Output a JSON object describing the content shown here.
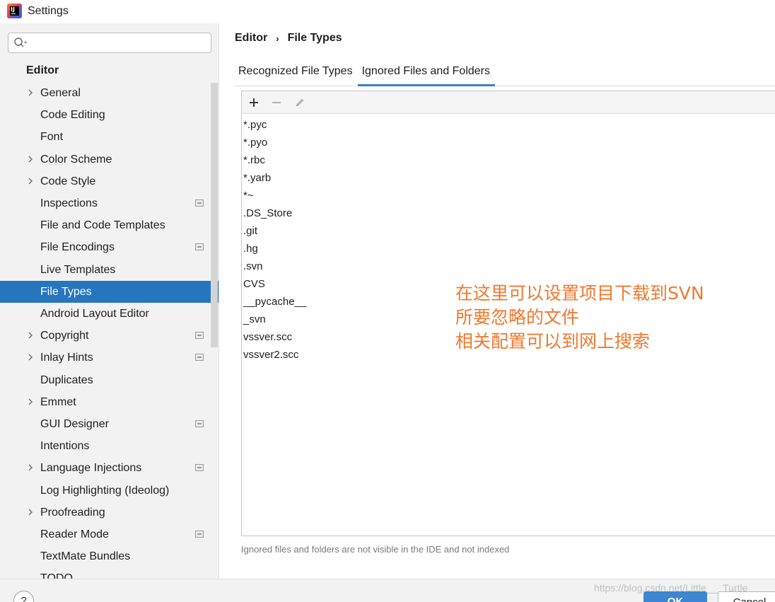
{
  "window": {
    "title": "Settings"
  },
  "search": {
    "placeholder": "",
    "value": ""
  },
  "sidebar": {
    "section": "Editor",
    "items": [
      {
        "label": "General",
        "expandable": true,
        "badge": false
      },
      {
        "label": "Code Editing",
        "expandable": false,
        "badge": false
      },
      {
        "label": "Font",
        "expandable": false,
        "badge": false
      },
      {
        "label": "Color Scheme",
        "expandable": true,
        "badge": false
      },
      {
        "label": "Code Style",
        "expandable": true,
        "badge": false
      },
      {
        "label": "Inspections",
        "expandable": false,
        "badge": true
      },
      {
        "label": "File and Code Templates",
        "expandable": false,
        "badge": false
      },
      {
        "label": "File Encodings",
        "expandable": false,
        "badge": true
      },
      {
        "label": "Live Templates",
        "expandable": false,
        "badge": false
      },
      {
        "label": "File Types",
        "expandable": false,
        "badge": false,
        "selected": true
      },
      {
        "label": "Android Layout Editor",
        "expandable": false,
        "badge": false
      },
      {
        "label": "Copyright",
        "expandable": true,
        "badge": true
      },
      {
        "label": "Inlay Hints",
        "expandable": true,
        "badge": true
      },
      {
        "label": "Duplicates",
        "expandable": false,
        "badge": false
      },
      {
        "label": "Emmet",
        "expandable": true,
        "badge": false
      },
      {
        "label": "GUI Designer",
        "expandable": false,
        "badge": true
      },
      {
        "label": "Intentions",
        "expandable": false,
        "badge": false
      },
      {
        "label": "Language Injections",
        "expandable": true,
        "badge": true
      },
      {
        "label": "Log Highlighting (Ideolog)",
        "expandable": false,
        "badge": false
      },
      {
        "label": "Proofreading",
        "expandable": true,
        "badge": false
      },
      {
        "label": "Reader Mode",
        "expandable": false,
        "badge": true
      },
      {
        "label": "TextMate Bundles",
        "expandable": false,
        "badge": false
      },
      {
        "label": "TODO",
        "expandable": false,
        "badge": false
      }
    ]
  },
  "breadcrumb": {
    "parent": "Editor",
    "separator": "›",
    "current": "File Types"
  },
  "tabs": [
    {
      "label": "Recognized File Types",
      "active": false
    },
    {
      "label": "Ignored Files and Folders",
      "active": true
    }
  ],
  "toolbar": {
    "add_icon": "plus-icon",
    "remove_icon": "minus-icon",
    "edit_icon": "pencil-icon"
  },
  "ignored_list": [
    "*.pyc",
    "*.pyo",
    "*.rbc",
    "*.yarb",
    "*~",
    ".DS_Store",
    ".git",
    ".hg",
    ".svn",
    "CVS",
    "__pycache__",
    "_svn",
    "vssver.scc",
    "vssver2.scc"
  ],
  "hint": "Ignored files and folders are not visible in the IDE and not indexed",
  "annotation": {
    "color": "#f0782e",
    "lines": [
      "在这里可以设置项目下载到SVN",
      "所要忽略的文件",
      "相关配置可以到网上搜索"
    ]
  },
  "footer": {
    "help_label": "?",
    "ok_label": "OK",
    "cancel_label": "Cancel",
    "watermark": "https://blog.csdn.net/Little___Turtle"
  },
  "colors": {
    "selection": "#2675bf",
    "accent": "#3a7fd0",
    "sidebar_bg": "#f2f2f2"
  }
}
